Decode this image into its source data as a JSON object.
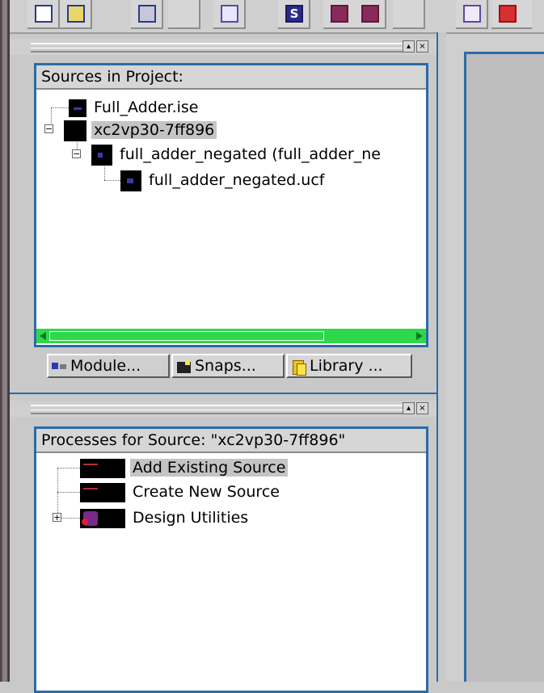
{
  "toolbar": {
    "buttons": [
      {
        "icon": "new-document-icon"
      },
      {
        "icon": "open-folder-icon"
      },
      {
        "icon": "save-icon"
      },
      {
        "icon": "blank"
      },
      {
        "icon": "edit-icon"
      },
      {
        "icon": "s-icon",
        "glyph": "S"
      },
      {
        "icon": "red-doc-icon"
      },
      {
        "icon": "red-doc2-icon"
      },
      {
        "icon": "blank"
      },
      {
        "icon": "image-icon"
      },
      {
        "icon": "acrobat-icon"
      }
    ]
  },
  "sources_panel": {
    "header": "Sources in Project:",
    "items": [
      {
        "label": "Full_Adder.ise",
        "selected": false
      },
      {
        "label": "xc2vp30-7ff896",
        "selected": true
      },
      {
        "label": "full_adder_negated (full_adder_ne",
        "selected": false
      },
      {
        "label": "full_adder_negated.ucf",
        "selected": false
      }
    ],
    "tabs": [
      {
        "label": "Module...",
        "icon": "module-icon"
      },
      {
        "label": "Snaps...",
        "icon": "snapshot-icon"
      },
      {
        "label": "Library ...",
        "icon": "library-icon"
      }
    ]
  },
  "processes_panel": {
    "header": "Processes for Source:  \"xc2vp30-7ff896\"",
    "items": [
      {
        "label": "Add Existing Source",
        "selected": true
      },
      {
        "label": "Create New Source",
        "selected": false
      },
      {
        "label": "Design Utilities",
        "selected": false
      }
    ]
  },
  "panel_buttons": {
    "float": "▴",
    "close": "×"
  },
  "colors": {
    "frame_blue": "#2c6aa8",
    "scroll_green": "#2fd84a",
    "selection_gray": "#c4c4c4",
    "panel_gray": "#cfcfcf"
  }
}
